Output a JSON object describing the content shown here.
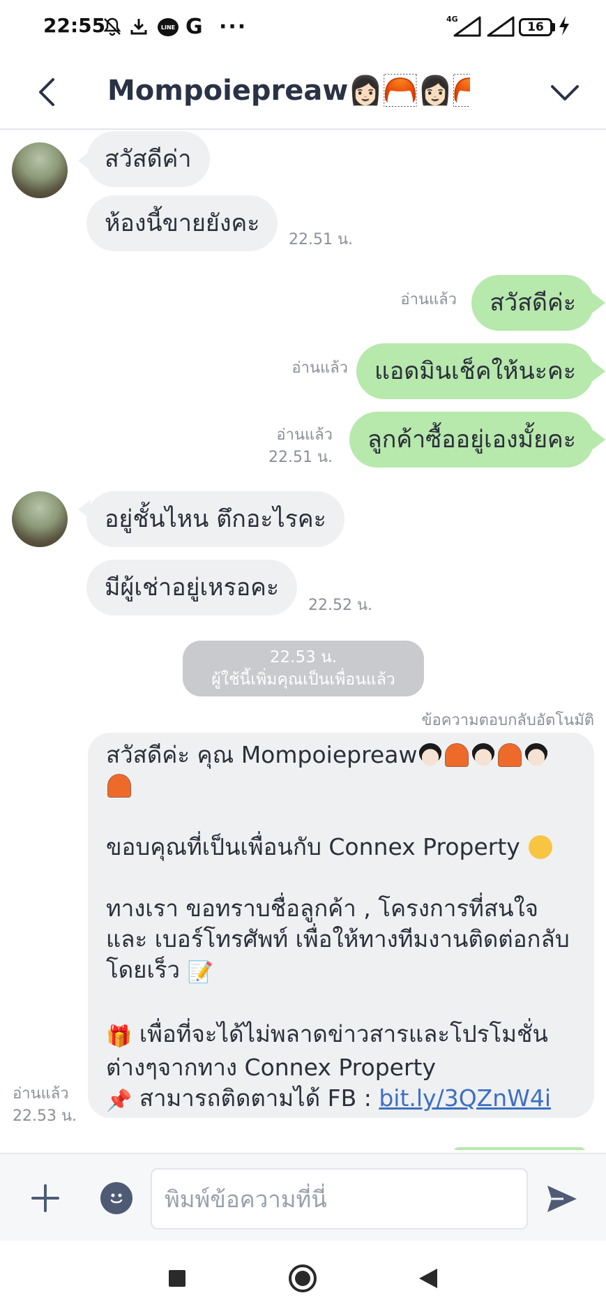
{
  "status_bar": {
    "time": "22:55",
    "icons": [
      "mute-bell-icon",
      "download-icon",
      "line-app-icon",
      "google-icon",
      "more-dots-icon"
    ],
    "network": "4G",
    "battery": "16",
    "line_badge": "LINE",
    "google_glyph": "G",
    "dots": "···"
  },
  "header": {
    "title": "Mompoiepreaw👩🏻🦰👩🏻🦰…",
    "back_icon": "chevron-left-icon",
    "expand_icon": "chevron-down-icon"
  },
  "messages": [
    {
      "side": "in",
      "text": "สวัสดีค่า"
    },
    {
      "side": "in",
      "text": "ห้องนี้ขายยังคะ",
      "time": "22.51 น."
    },
    {
      "side": "out",
      "text": "สวัสดีค่ะ",
      "read": "อ่านแล้ว"
    },
    {
      "side": "out",
      "text": "แอดมินเช็คให้นะคะ",
      "read": "อ่านแล้ว"
    },
    {
      "side": "out",
      "text": "ลูกค้าซื้ออยู่เองมั้ยคะ",
      "read": "อ่านแล้ว",
      "time": "22.51 น."
    },
    {
      "side": "in",
      "text": "อยู่ชั้นไหน ตึกอะไรคะ"
    },
    {
      "side": "in",
      "text": "มีผู้เช่าอยู่เหรอคะ",
      "time": "22.52 น."
    }
  ],
  "system_notice": {
    "time": "22.53 น.",
    "text": "ผู้ใช้นี้เพิ่มคุณเป็นเพื่อนแล้ว"
  },
  "auto_reply": {
    "label": "ข้อความตอบกลับอัตโนมัติ",
    "greeting": "สวัสดีค่ะ คุณ Mompoiepreaw",
    "thanks": "ขอบคุณที่เป็นเพื่อนกับ Connex Property",
    "request": "ทางเรา ขอทราบชื่อลูกค้า , โครงการที่สนใจ และ เบอร์โทรศัพท์ เพื่อให้ทางทีมงานติดต่อกลับโดยเร็ว",
    "promo": "เพื่อที่จะได้ไม่พลาดข่าวสารและโปรโมชั่นต่างๆจากทาง Connex Property",
    "follow": "สามารถติดตามได้ FB : ",
    "link": "bit.ly/3QZnW4i",
    "read": "อ่านแล้ว",
    "time": "22.53 น.",
    "emoji_memo": "📝",
    "emoji_gift": "🎁",
    "emoji_pin": "📌"
  },
  "input_bar": {
    "placeholder": "พิมพ์ข้อความที่นี่",
    "add_icon": "plus-icon",
    "emoji_icon": "emoji-icon",
    "send_icon": "send-icon"
  },
  "nav_bar": {
    "icons": [
      "recent-apps-icon",
      "home-icon",
      "back-icon"
    ]
  },
  "colors": {
    "incoming_bubble": "#eff0f2",
    "outgoing_bubble": "#b7e8ac",
    "link": "#3d6fc2",
    "meta_text": "#8b8f98"
  }
}
